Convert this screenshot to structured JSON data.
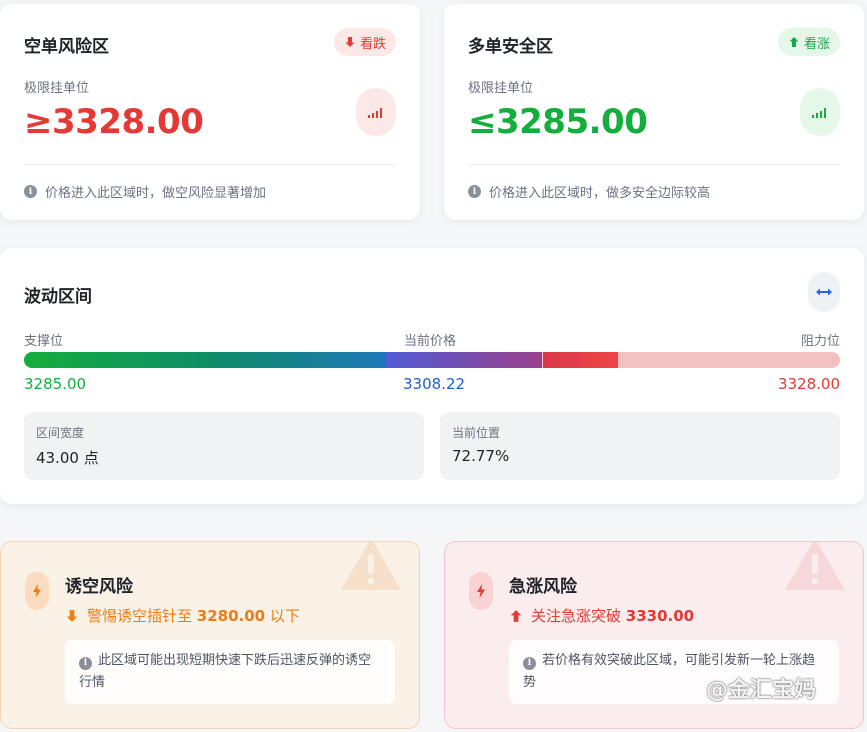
{
  "short_zone": {
    "title": "空单风险区",
    "badge": "看跌",
    "label": "极限挂单位",
    "price": "≥3328.00",
    "note": "价格进入此区域时，做空风险显著增加",
    "color": "#e53935"
  },
  "long_zone": {
    "title": "多单安全区",
    "badge": "看涨",
    "label": "极限挂单位",
    "price": "≤3285.00",
    "note": "价格进入此区域时，做多安全边际较高",
    "color": "#13ae3c"
  },
  "range": {
    "title": "波动区间",
    "support_label": "支撑位",
    "current_label": "当前价格",
    "resistance_label": "阻力位",
    "support_value": "3285.00",
    "current_value": "3308.22",
    "resistance_value": "3328.00",
    "position_fraction": 0.7277,
    "width_label": "区间宽度",
    "width_value": "43.00 点",
    "position_label": "当前位置",
    "position_value": "72.77%"
  },
  "trap_risk": {
    "title": "诱空风险",
    "line_prefix": "警惕诱空插针至",
    "line_price": "3280.00",
    "line_suffix": "以下",
    "note": "此区域可能出现短期快速下跌后迅速反弹的诱空行情"
  },
  "squeeze_risk": {
    "title": "急涨风险",
    "line_prefix": "关注急涨突破",
    "line_price": "3330.00",
    "note": "若价格有效突破此区域，可能引发新一轮上涨趋势"
  },
  "watermark": "@金汇宝妈"
}
